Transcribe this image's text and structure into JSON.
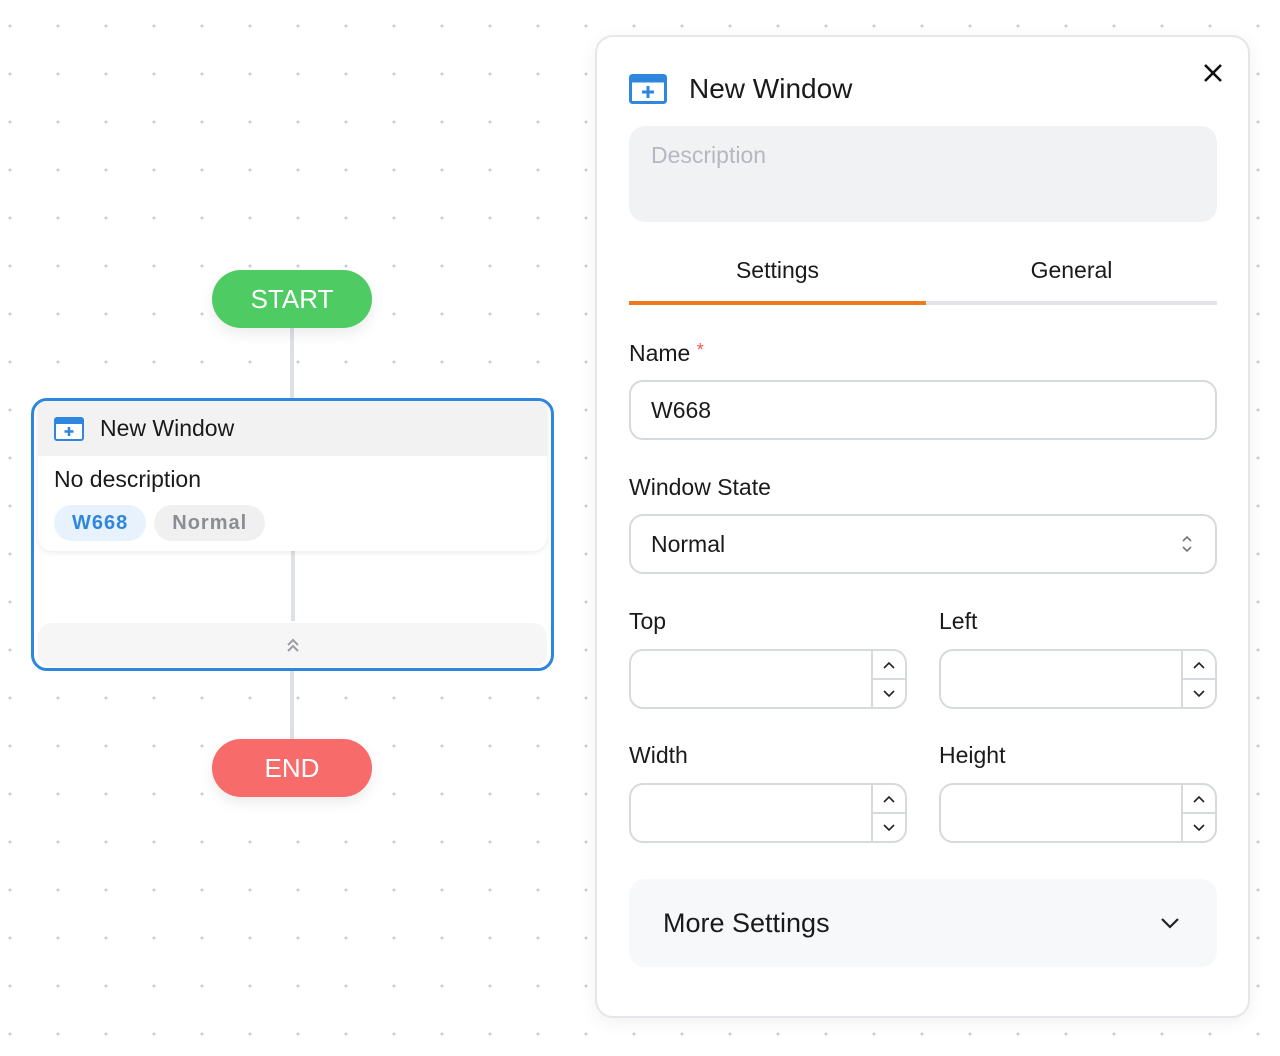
{
  "canvas": {
    "start_label": "START",
    "end_label": "END",
    "node": {
      "title": "New Window",
      "description": "No description",
      "tags": [
        "W668",
        "Normal"
      ]
    }
  },
  "panel": {
    "title": "New Window",
    "description_placeholder": "Description",
    "tabs": [
      {
        "label": "Settings",
        "active": true
      },
      {
        "label": "General",
        "active": false
      }
    ],
    "fields": {
      "name_label": "Name",
      "name_required": "*",
      "name_value": "W668",
      "window_state_label": "Window State",
      "window_state_value": "Normal",
      "top_label": "Top",
      "left_label": "Left",
      "width_label": "Width",
      "height_label": "Height"
    },
    "more_settings": "More Settings"
  },
  "colors": {
    "accent": "#2e86de",
    "tab_active": "#f07a1a",
    "start": "#4fcb63",
    "end": "#f76b6b"
  }
}
